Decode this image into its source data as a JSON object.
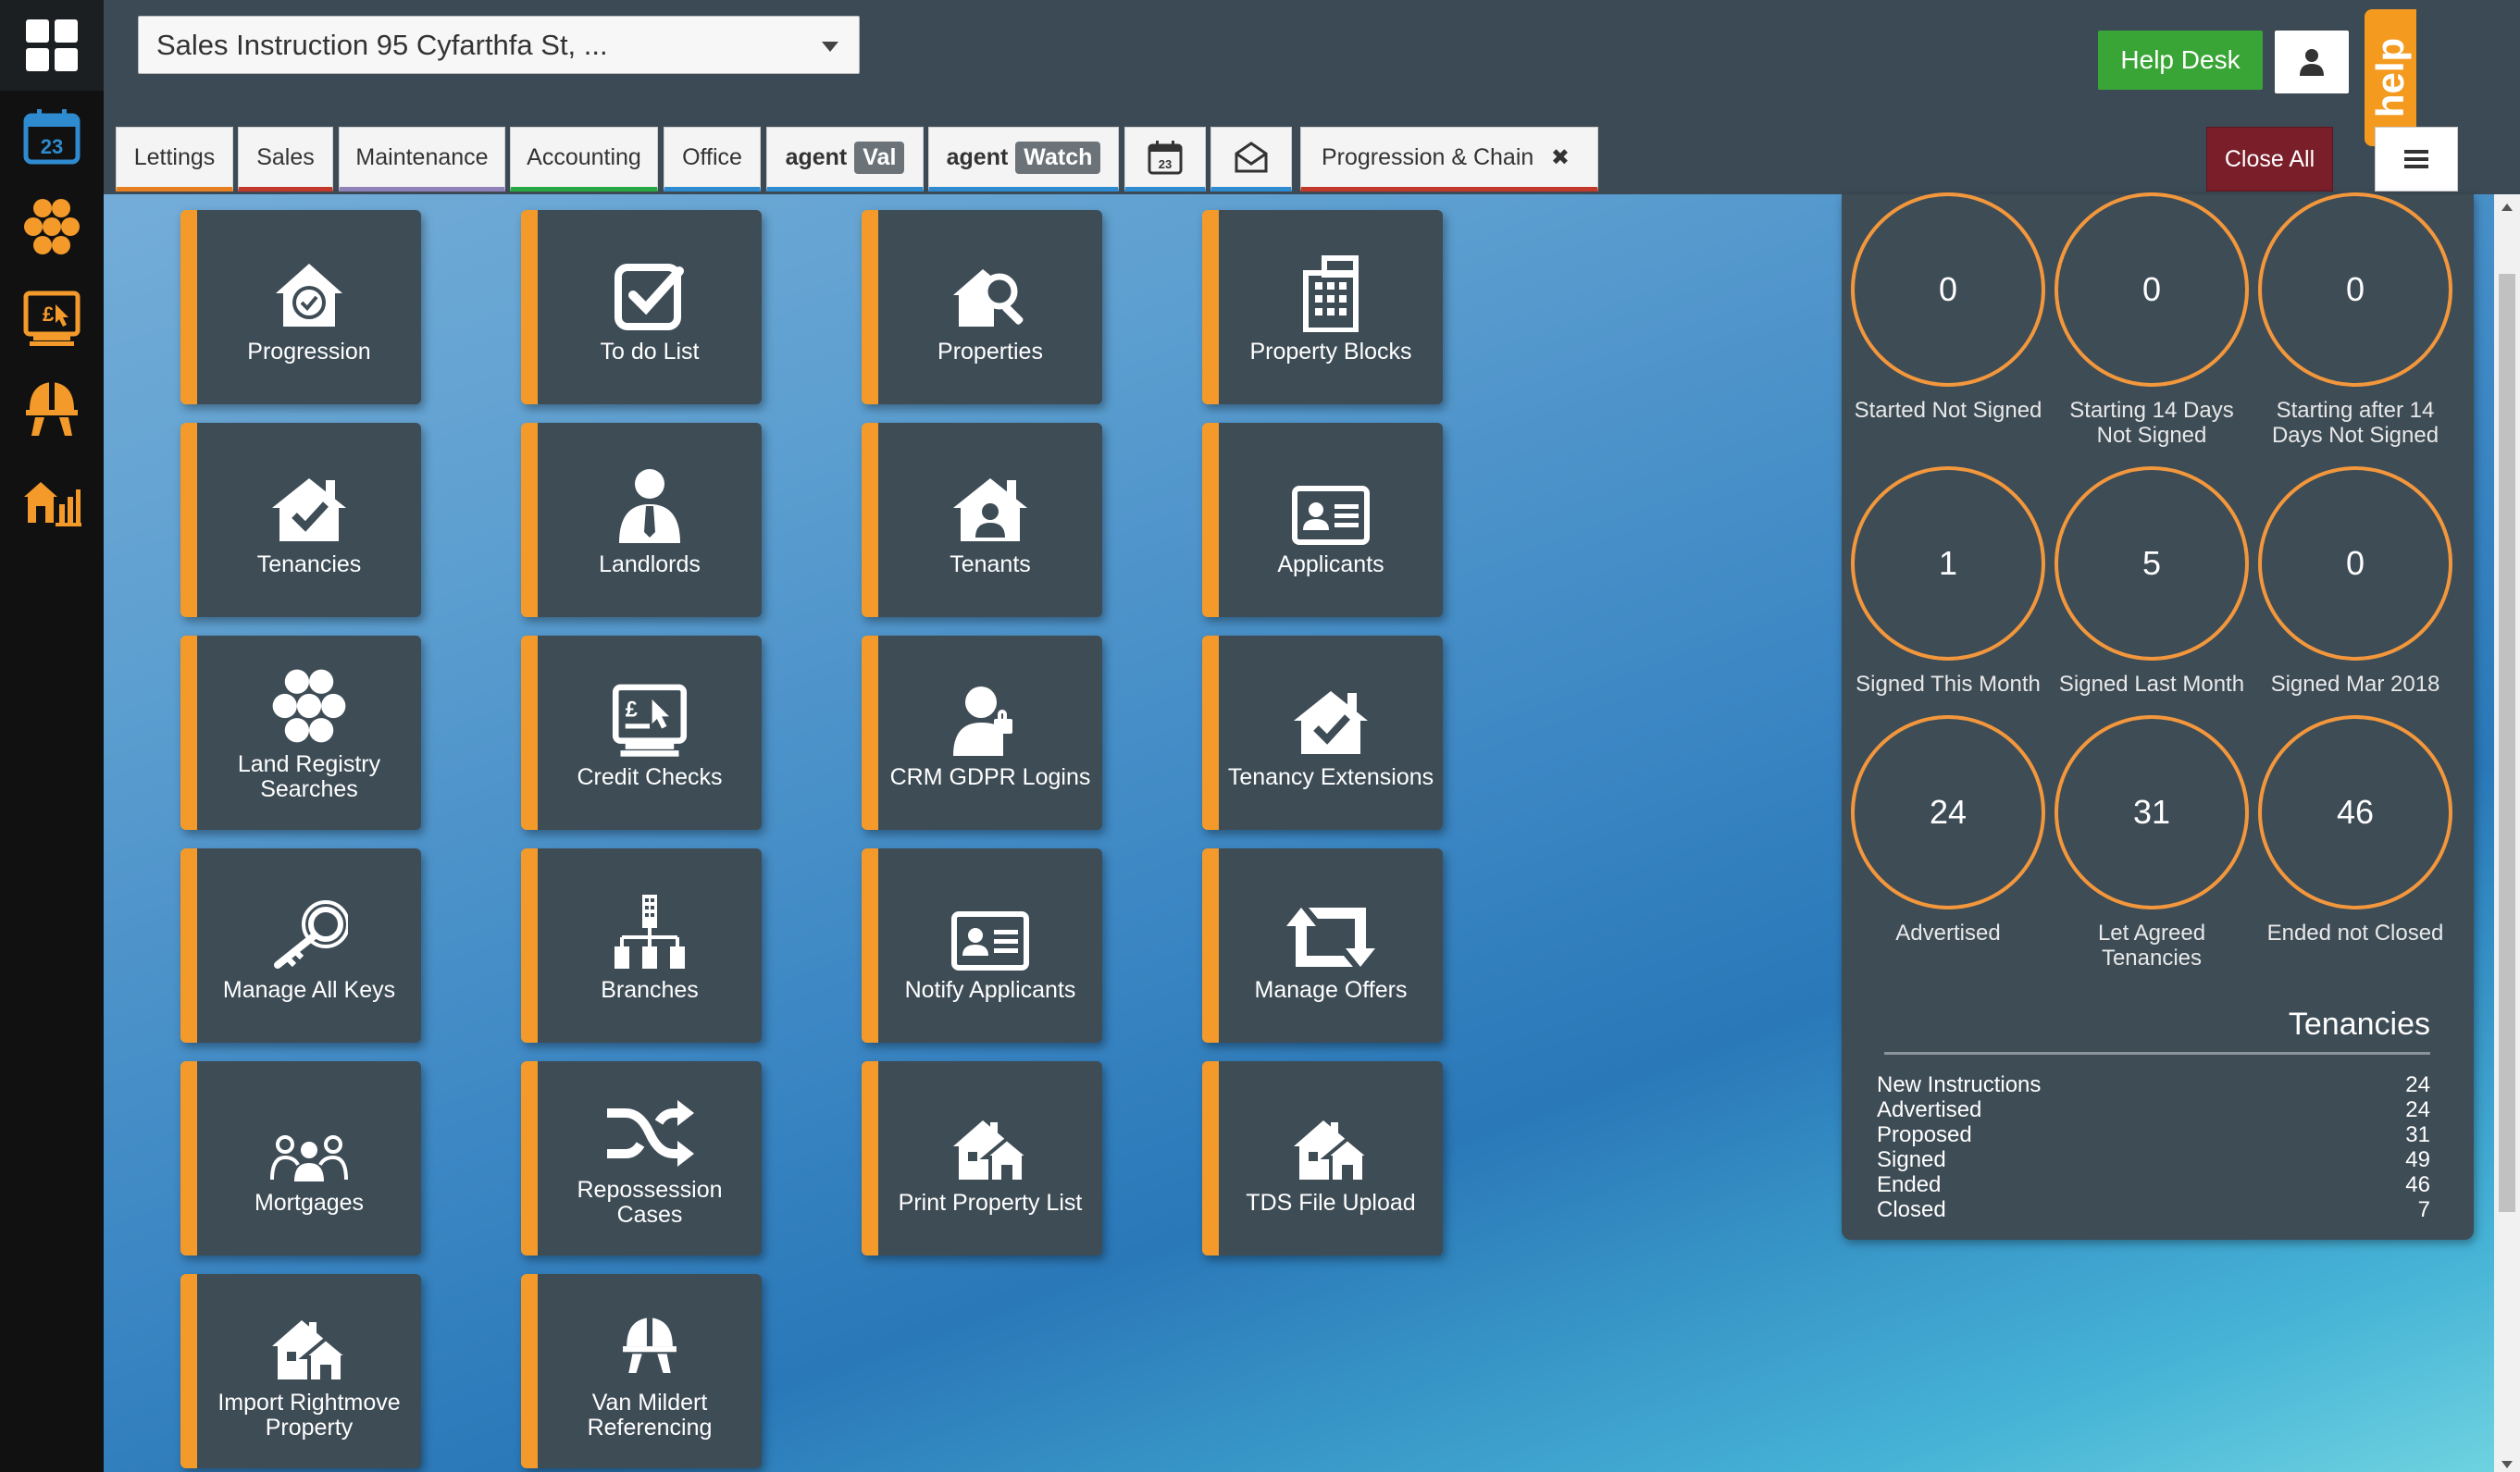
{
  "header": {
    "property_select": "Sales Instruction 95 Cyfarthfa St, ...",
    "help_desk": "Help Desk",
    "help_tab": "help",
    "close_all": "Close All"
  },
  "tabs": [
    {
      "label": "Lettings",
      "color": "#e67e22"
    },
    {
      "label": "Sales",
      "color": "#c0392b"
    },
    {
      "label": "Maintenance",
      "color": "#8e82b8"
    },
    {
      "label": "Accounting",
      "color": "#27a844"
    },
    {
      "label": "Office",
      "color": "#2e8bd0"
    },
    {
      "label": "agent",
      "tag": "Val",
      "color": "#2e8bd0"
    },
    {
      "label": "agent",
      "tag": "Watch",
      "color": "#2e8bd0"
    },
    {
      "label": "Progression & Chain",
      "color": "#c0392b"
    }
  ],
  "tiles": [
    {
      "label": "Progression",
      "icon": "progression-icon"
    },
    {
      "label": "To do List",
      "icon": "checkbox-icon"
    },
    {
      "label": "Properties",
      "icon": "house-search-icon"
    },
    {
      "label": "Property Blocks",
      "icon": "building-icon"
    },
    {
      "label": "Tenancies",
      "icon": "house-check-icon"
    },
    {
      "label": "Landlords",
      "icon": "person-tie-icon"
    },
    {
      "label": "Tenants",
      "icon": "house-person-icon"
    },
    {
      "label": "Applicants",
      "icon": "id-card-icon"
    },
    {
      "label": "Land Registry Searches",
      "icon": "hexagons-icon"
    },
    {
      "label": "Credit Checks",
      "icon": "credit-check-icon"
    },
    {
      "label": "CRM GDPR Logins",
      "icon": "user-lock-icon"
    },
    {
      "label": "Tenancy Extensions",
      "icon": "house-check-icon"
    },
    {
      "label": "Manage All Keys",
      "icon": "key-icon"
    },
    {
      "label": "Branches",
      "icon": "branches-icon"
    },
    {
      "label": "Notify Applicants",
      "icon": "id-card-icon"
    },
    {
      "label": "Manage Offers",
      "icon": "retweet-icon"
    },
    {
      "label": "Mortgages",
      "icon": "people-icon"
    },
    {
      "label": "Repossession Cases",
      "icon": "shuffle-icon"
    },
    {
      "label": "Print Property List",
      "icon": "houses-icon"
    },
    {
      "label": "TDS File Upload",
      "icon": "houses-icon"
    },
    {
      "label": "Import Rightmove Property",
      "icon": "houses-icon"
    },
    {
      "label": "Van Mildert Referencing",
      "icon": "hardhat-icon"
    }
  ],
  "stats": [
    {
      "value": "0",
      "label": "Started Not Signed"
    },
    {
      "value": "0",
      "label": "Starting 14 Days Not Signed"
    },
    {
      "value": "0",
      "label": "Starting after 14 Days Not Signed"
    },
    {
      "value": "1",
      "label": "Signed This Month"
    },
    {
      "value": "5",
      "label": "Signed Last Month"
    },
    {
      "value": "0",
      "label": "Signed Mar 2018"
    },
    {
      "value": "24",
      "label": "Advertised"
    },
    {
      "value": "31",
      "label": "Let Agreed Tenancies"
    },
    {
      "value": "46",
      "label": "Ended not Closed"
    }
  ],
  "tenancies": {
    "title": "Tenancies",
    "rows": [
      {
        "label": "New Instructions",
        "value": "24"
      },
      {
        "label": "Advertised",
        "value": "24"
      },
      {
        "label": "Proposed",
        "value": "31"
      },
      {
        "label": "Signed",
        "value": "49"
      },
      {
        "label": "Ended",
        "value": "46"
      },
      {
        "label": "Closed",
        "value": "7"
      }
    ]
  },
  "rail_icons": [
    "dashboard-icon",
    "calendar-icon",
    "hexagons-icon",
    "credit-check-icon",
    "hardhat-icon",
    "house-chart-icon"
  ],
  "calendar_day": "23",
  "accent_color": "#f39a2b"
}
